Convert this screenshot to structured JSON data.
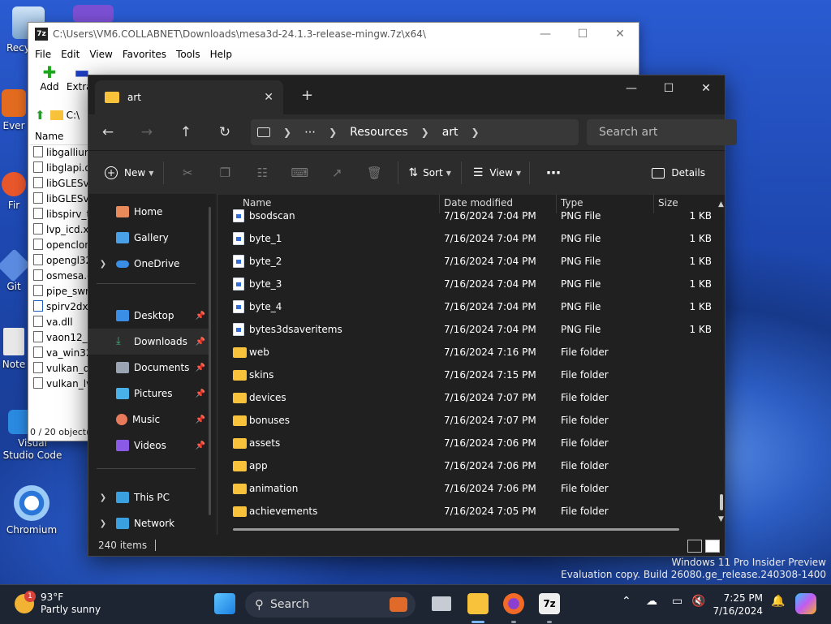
{
  "desktop": {
    "icons": [
      {
        "id": "recycle",
        "label": "Recy"
      },
      {
        "id": "ever",
        "label": "Ever"
      },
      {
        "id": "fir",
        "label": "Fir"
      },
      {
        "id": "git",
        "label": "Git"
      },
      {
        "id": "note",
        "label": "Note"
      },
      {
        "id": "vscode",
        "label": "Visual Studio Code"
      },
      {
        "id": "chromium",
        "label": "Chromium"
      }
    ],
    "watermark": {
      "line1": "Windows 11 Pro Insider Preview",
      "line2": "Evaluation copy. Build 26080.ge_release.240308-1400"
    }
  },
  "zip_window": {
    "title": "C:\\Users\\VM6.COLLABNET\\Downloads\\mesa3d-24.1.3-release-mingw.7z\\x64\\",
    "menu": [
      "File",
      "Edit",
      "View",
      "Favorites",
      "Tools",
      "Help"
    ],
    "toolbar": [
      {
        "label": "Add",
        "icon": "plus-icon"
      },
      {
        "label": "Extrac",
        "icon": "extract-icon"
      }
    ],
    "address": "C:\\",
    "column_header": "Name",
    "files": [
      "libgallium",
      "libglapi.d",
      "libGLESv1",
      "libGLESv2",
      "libspirv_t",
      "lvp_icd.x8",
      "openclon",
      "opengl32",
      "osmesa.d",
      "pipe_swra",
      "spirv2dxil",
      "va.dll",
      "vaon12_d",
      "va_win32.",
      "vulkan_dz",
      "vulkan_lv"
    ],
    "status": "0 / 20 object(s"
  },
  "explorer": {
    "tab_title": "art",
    "breadcrumb": [
      "Resources",
      "art"
    ],
    "search_placeholder": "Search art",
    "commands": {
      "new": "New",
      "sort": "Sort",
      "view": "View",
      "details": "Details"
    },
    "nav": [
      {
        "id": "home",
        "label": "Home",
        "pinned": false,
        "expandable": false
      },
      {
        "id": "gallery",
        "label": "Gallery",
        "pinned": false,
        "expandable": false
      },
      {
        "id": "onedrive",
        "label": "OneDrive",
        "pinned": false,
        "expandable": true
      },
      {
        "id": "desktop",
        "label": "Desktop",
        "pinned": true,
        "expandable": false
      },
      {
        "id": "downloads",
        "label": "Downloads",
        "pinned": true,
        "expandable": false,
        "selected": true
      },
      {
        "id": "documents",
        "label": "Documents",
        "pinned": true,
        "expandable": false
      },
      {
        "id": "pictures",
        "label": "Pictures",
        "pinned": true,
        "expandable": false
      },
      {
        "id": "music",
        "label": "Music",
        "pinned": true,
        "expandable": false
      },
      {
        "id": "videos",
        "label": "Videos",
        "pinned": true,
        "expandable": false
      },
      {
        "id": "thispc",
        "label": "This PC",
        "pinned": false,
        "expandable": true
      },
      {
        "id": "network",
        "label": "Network",
        "pinned": false,
        "expandable": true
      }
    ],
    "columns": {
      "name": "Name",
      "date": "Date modified",
      "type": "Type",
      "size": "Size"
    },
    "files": [
      {
        "name": "bsodscan",
        "date": "7/16/2024 7:04 PM",
        "type": "PNG File",
        "size": "1 KB",
        "kind": "png"
      },
      {
        "name": "byte_1",
        "date": "7/16/2024 7:04 PM",
        "type": "PNG File",
        "size": "1 KB",
        "kind": "png"
      },
      {
        "name": "byte_2",
        "date": "7/16/2024 7:04 PM",
        "type": "PNG File",
        "size": "1 KB",
        "kind": "png"
      },
      {
        "name": "byte_3",
        "date": "7/16/2024 7:04 PM",
        "type": "PNG File",
        "size": "1 KB",
        "kind": "png"
      },
      {
        "name": "byte_4",
        "date": "7/16/2024 7:04 PM",
        "type": "PNG File",
        "size": "1 KB",
        "kind": "png"
      },
      {
        "name": "bytes3dsaveritems",
        "date": "7/16/2024 7:04 PM",
        "type": "PNG File",
        "size": "1 KB",
        "kind": "png"
      },
      {
        "name": "web",
        "date": "7/16/2024 7:16 PM",
        "type": "File folder",
        "size": "",
        "kind": "folder"
      },
      {
        "name": "skins",
        "date": "7/16/2024 7:15 PM",
        "type": "File folder",
        "size": "",
        "kind": "folder"
      },
      {
        "name": "devices",
        "date": "7/16/2024 7:07 PM",
        "type": "File folder",
        "size": "",
        "kind": "folder"
      },
      {
        "name": "bonuses",
        "date": "7/16/2024 7:07 PM",
        "type": "File folder",
        "size": "",
        "kind": "folder"
      },
      {
        "name": "assets",
        "date": "7/16/2024 7:06 PM",
        "type": "File folder",
        "size": "",
        "kind": "folder"
      },
      {
        "name": "app",
        "date": "7/16/2024 7:06 PM",
        "type": "File folder",
        "size": "",
        "kind": "folder"
      },
      {
        "name": "animation",
        "date": "7/16/2024 7:06 PM",
        "type": "File folder",
        "size": "",
        "kind": "folder"
      },
      {
        "name": "achievements",
        "date": "7/16/2024 7:05 PM",
        "type": "File folder",
        "size": "",
        "kind": "folder"
      }
    ],
    "status": "240 items"
  },
  "taskbar": {
    "weather": {
      "temp": "93°F",
      "desc": "Partly sunny",
      "badge": "1"
    },
    "search": "Search",
    "time": "7:25 PM",
    "date": "7/16/2024"
  },
  "colors": {
    "folder": "#f8c23a",
    "accent": "#7ab6ff",
    "explorer_bg": "#202020"
  }
}
